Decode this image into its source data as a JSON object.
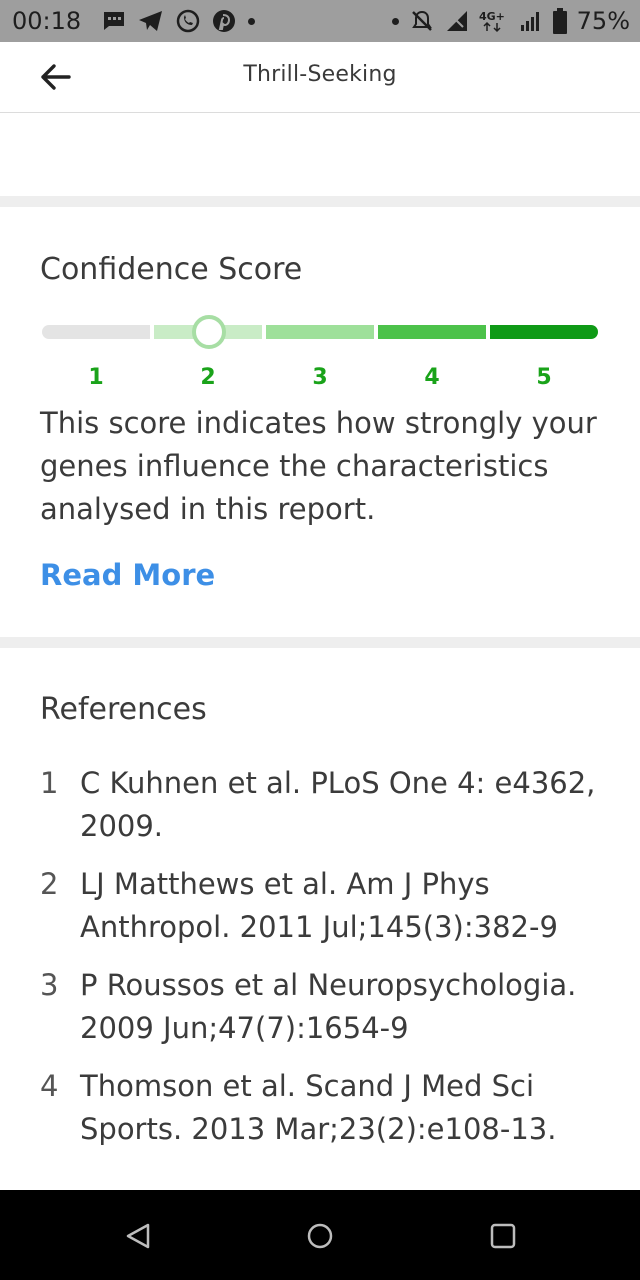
{
  "status_bar": {
    "time": "00:18",
    "battery": "75%",
    "left_icons": [
      "message-icon",
      "telegram-icon",
      "whatsapp-icon",
      "pinterest-icon",
      "dot-icon"
    ],
    "right_icons": [
      "dot-icon",
      "mute-icon",
      "signal-icon",
      "lte-icon",
      "signal-icon",
      "battery-icon"
    ]
  },
  "app_bar": {
    "title": "Thrill-Seeking",
    "back_icon": "arrow-left-icon"
  },
  "confidence": {
    "title": "Confidence Score",
    "levels": [
      "1",
      "2",
      "3",
      "4",
      "5"
    ],
    "selected_level": 2,
    "segment_colors": [
      "#e4e4e4",
      "#c9ecc6",
      "#9ee09a",
      "#4cc24a",
      "#0f9a16"
    ],
    "label_color": "#1aa31a",
    "description": "This score indicates how strongly your genes influence the characteristics analysed in this report.",
    "read_more": "Read More",
    "link_color": "#3d8fe6"
  },
  "references": {
    "title": "References",
    "items": [
      {
        "num": "1",
        "text": "C Kuhnen et al. PLoS One 4: e4362, 2009."
      },
      {
        "num": "2",
        "text": "LJ Matthews et al. Am J Phys Anthropol. 2011 Jul;145(3):382-9"
      },
      {
        "num": "3",
        "text": "P Roussos et al Neuropsychologia. 2009 Jun;47(7):1654-9"
      },
      {
        "num": "4",
        "text": "Thomson et al. Scand J Med Sci Sports. 2013 Mar;23(2):e108-13."
      }
    ]
  },
  "nav_bar": {
    "buttons": [
      "back-triangle-icon",
      "home-circle-icon",
      "recents-square-icon"
    ]
  }
}
